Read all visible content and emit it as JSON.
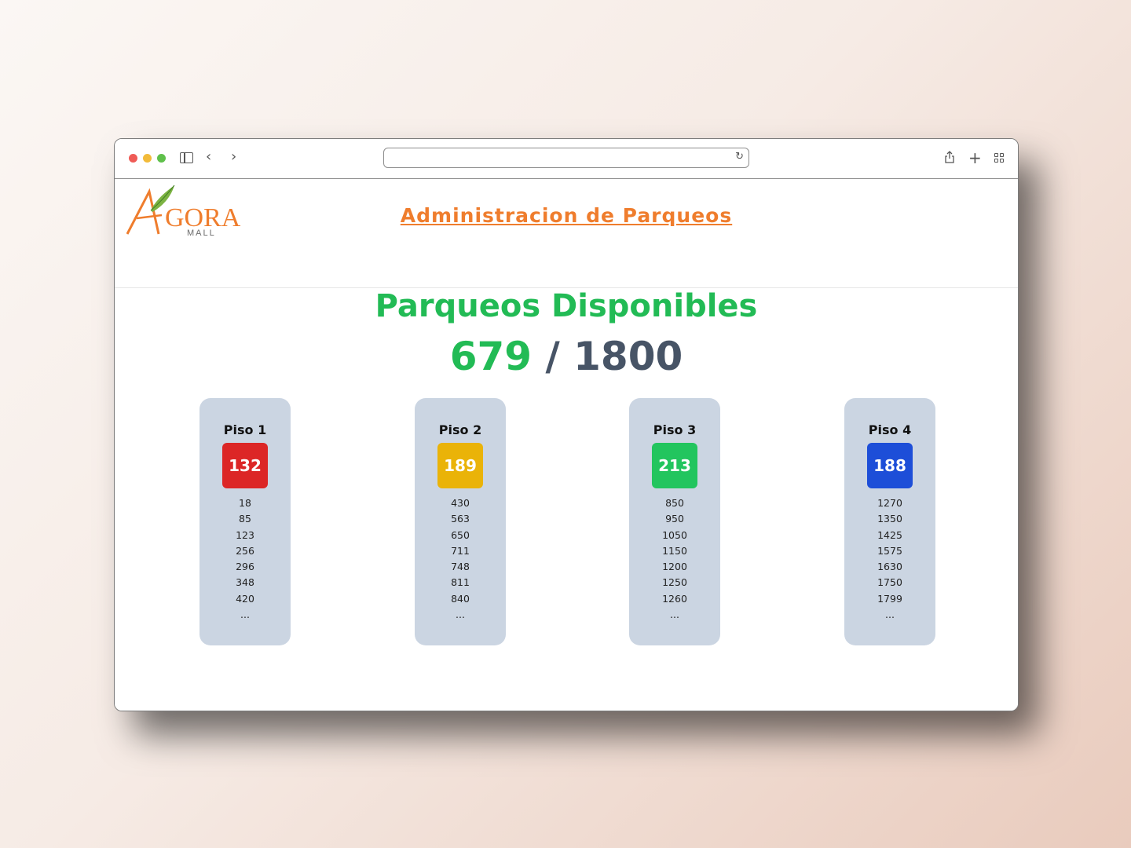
{
  "header": {
    "title": "Administracion de Parqueos",
    "logo": {
      "wordmark": "GORA",
      "subtitle": "MALL",
      "initial": "A"
    }
  },
  "summary": {
    "title": "Parqueos Disponibles",
    "available": "679",
    "separator": " / ",
    "total": "1800"
  },
  "floors": [
    {
      "name": "Piso 1",
      "count": "132",
      "color": "#dc2626",
      "spots": [
        "18",
        "85",
        "123",
        "256",
        "296",
        "348",
        "420",
        "..."
      ]
    },
    {
      "name": "Piso 2",
      "count": "189",
      "color": "#eab308",
      "spots": [
        "430",
        "563",
        "650",
        "711",
        "748",
        "811",
        "840",
        "..."
      ]
    },
    {
      "name": "Piso 3",
      "count": "213",
      "color": "#22c55e",
      "spots": [
        "850",
        "950",
        "1050",
        "1150",
        "1200",
        "1250",
        "1260",
        "..."
      ]
    },
    {
      "name": "Piso 4",
      "count": "188",
      "color": "#1d4ed8",
      "spots": [
        "1270",
        "1350",
        "1425",
        "1575",
        "1630",
        "1750",
        "1799",
        "..."
      ]
    }
  ],
  "colors": {
    "accent_orange": "#ef7d2d",
    "accent_green": "#22bb55",
    "card_bg": "#cbd5e2",
    "text_slate": "#475466"
  },
  "browser": {
    "icons": [
      "sidebar-toggle-icon",
      "back-icon",
      "forward-icon",
      "reload-icon",
      "share-icon",
      "new-tab-icon",
      "tab-overview-icon"
    ]
  }
}
